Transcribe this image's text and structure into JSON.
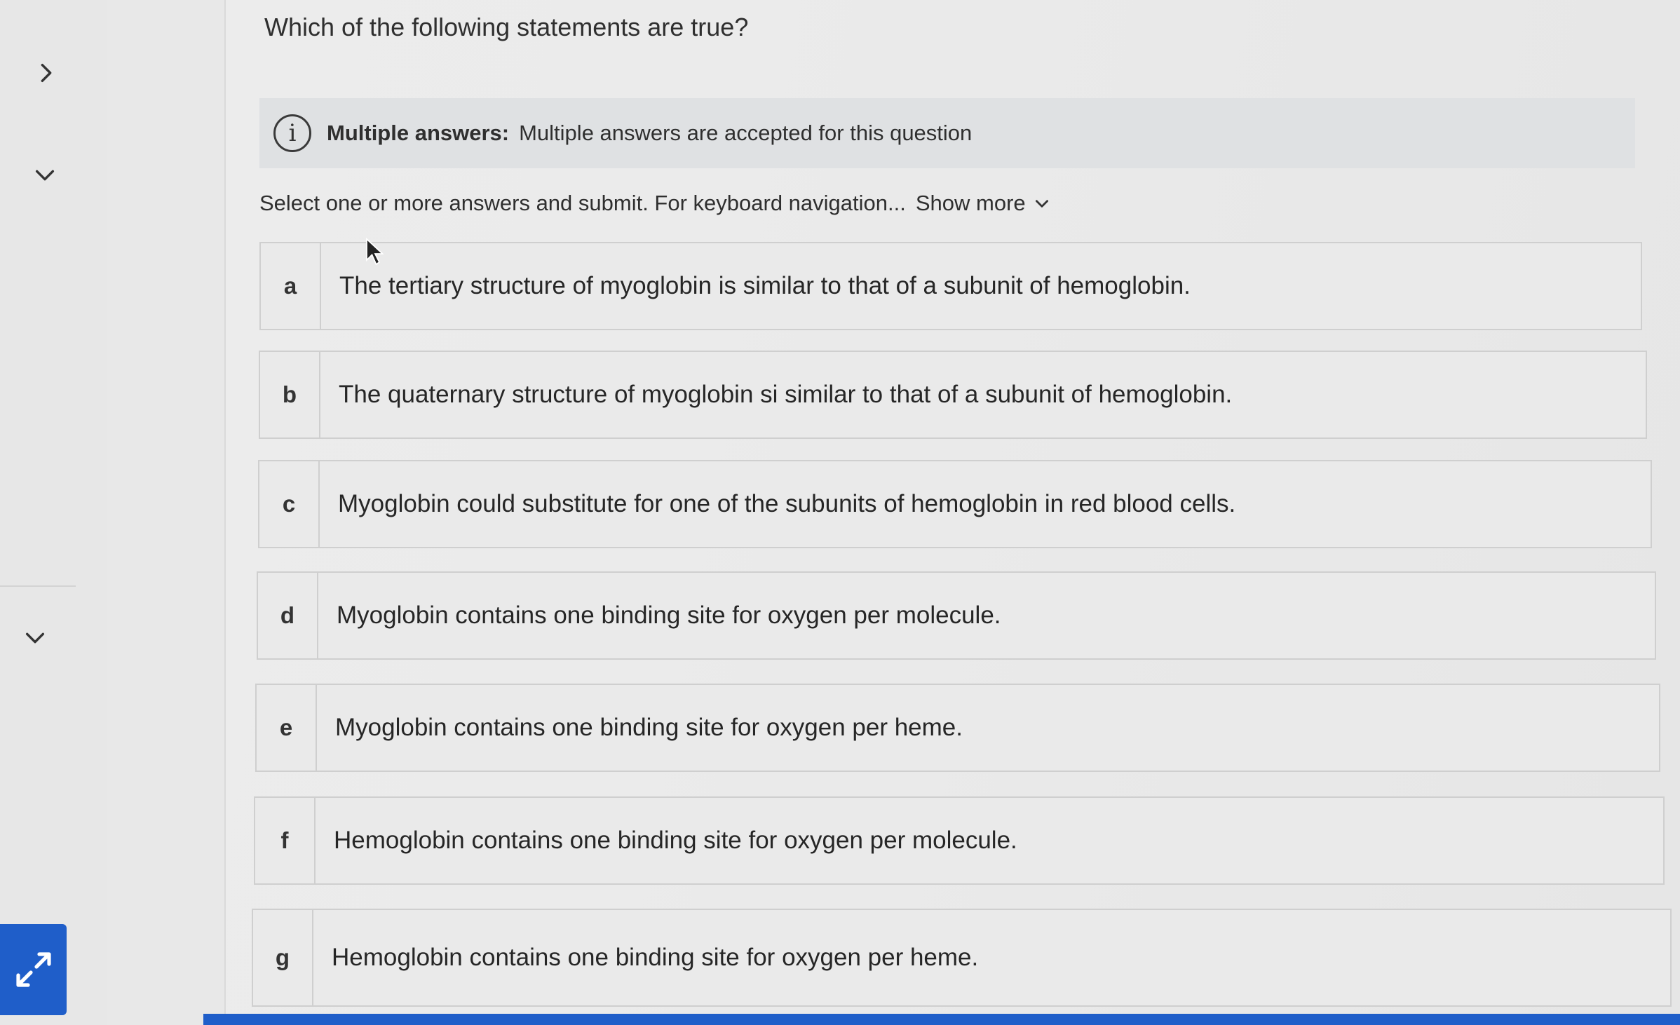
{
  "question": {
    "text": "Which of the following statements are true?"
  },
  "info": {
    "icon": "info-icon",
    "glyph": "i",
    "label": "Multiple answers:",
    "text": "Multiple answers are accepted for this question"
  },
  "instructions": {
    "text": "Select one or more answers and submit. For keyboard navigation...",
    "show_more": "Show more"
  },
  "options": [
    {
      "letter": "a",
      "text": "The tertiary structure of myoglobin is similar to that of a subunit of hemoglobin."
    },
    {
      "letter": "b",
      "text": "The quaternary structure of myoglobin si similar to that of a subunit of hemoglobin."
    },
    {
      "letter": "c",
      "text": "Myoglobin could substitute for one of the subunits of hemoglobin in red blood cells."
    },
    {
      "letter": "d",
      "text": "Myoglobin contains one binding site for oxygen per molecule."
    },
    {
      "letter": "e",
      "text": "Myoglobin contains one binding site for oxygen per heme."
    },
    {
      "letter": "f",
      "text": "Hemoglobin contains one binding site for oxygen per molecule."
    },
    {
      "letter": "g",
      "text": "Hemoglobin contains one binding site for oxygen per heme."
    }
  ],
  "rail": {
    "icons": [
      "chevron-right-icon",
      "chevron-down-icon",
      "chevron-down-icon"
    ],
    "expand_icon": "expand-arrows-icon"
  },
  "colors": {
    "accent": "#1f5ec9",
    "info_bg": "#dfe1e3"
  }
}
